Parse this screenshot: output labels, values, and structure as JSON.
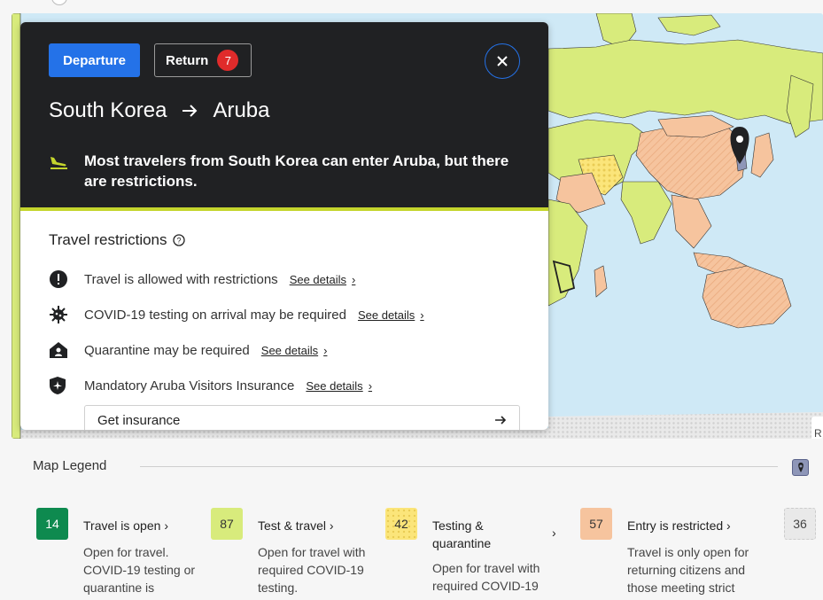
{
  "trip": {
    "departure_label": "Departure",
    "return_label": "Return",
    "return_count": "7",
    "origin": "South Korea",
    "destination": "Aruba",
    "notice": "Most travelers from South Korea can enter Aruba, but there are restrictions."
  },
  "restrictions": {
    "title": "Travel restrictions",
    "see_details": "See details",
    "items": [
      {
        "icon": "exclamation-icon",
        "text": "Travel is allowed with restrictions"
      },
      {
        "icon": "virus-icon",
        "text": "COVID-19 testing on arrival may be required"
      },
      {
        "icon": "quarantine-house-icon",
        "text": "Quarantine may be required"
      },
      {
        "icon": "shield-plane-icon",
        "text": "Mandatory Aruba Visitors Insurance"
      }
    ],
    "insurance_button": "Get insurance"
  },
  "map": {
    "edge_label": "R"
  },
  "legend": {
    "title": "Map Legend",
    "items": [
      {
        "count": "14",
        "name": "Travel is open",
        "desc": "Open for travel. COVID-19 testing or quarantine is",
        "color": "#0e8a4f"
      },
      {
        "count": "87",
        "name": "Test & travel",
        "desc": "Open for travel with required COVID-19 testing.",
        "color": "#d8eb7c"
      },
      {
        "count": "42",
        "name": "Testing & quarantine",
        "desc": "Open for travel with required COVID-19",
        "color": "#fbe57a"
      },
      {
        "count": "57",
        "name": "Entry is restricted",
        "desc": "Travel is only open for returning citizens and those meeting strict",
        "color": "#f6c49e"
      },
      {
        "count": "36",
        "color": "#e9e9e9"
      }
    ]
  },
  "colors": {
    "accent_blue": "#2472e8",
    "badge_red": "#e02b2b",
    "panel_dark": "#202123",
    "accent_lime": "#c4d52d",
    "map_water": "#cfe9f6"
  }
}
